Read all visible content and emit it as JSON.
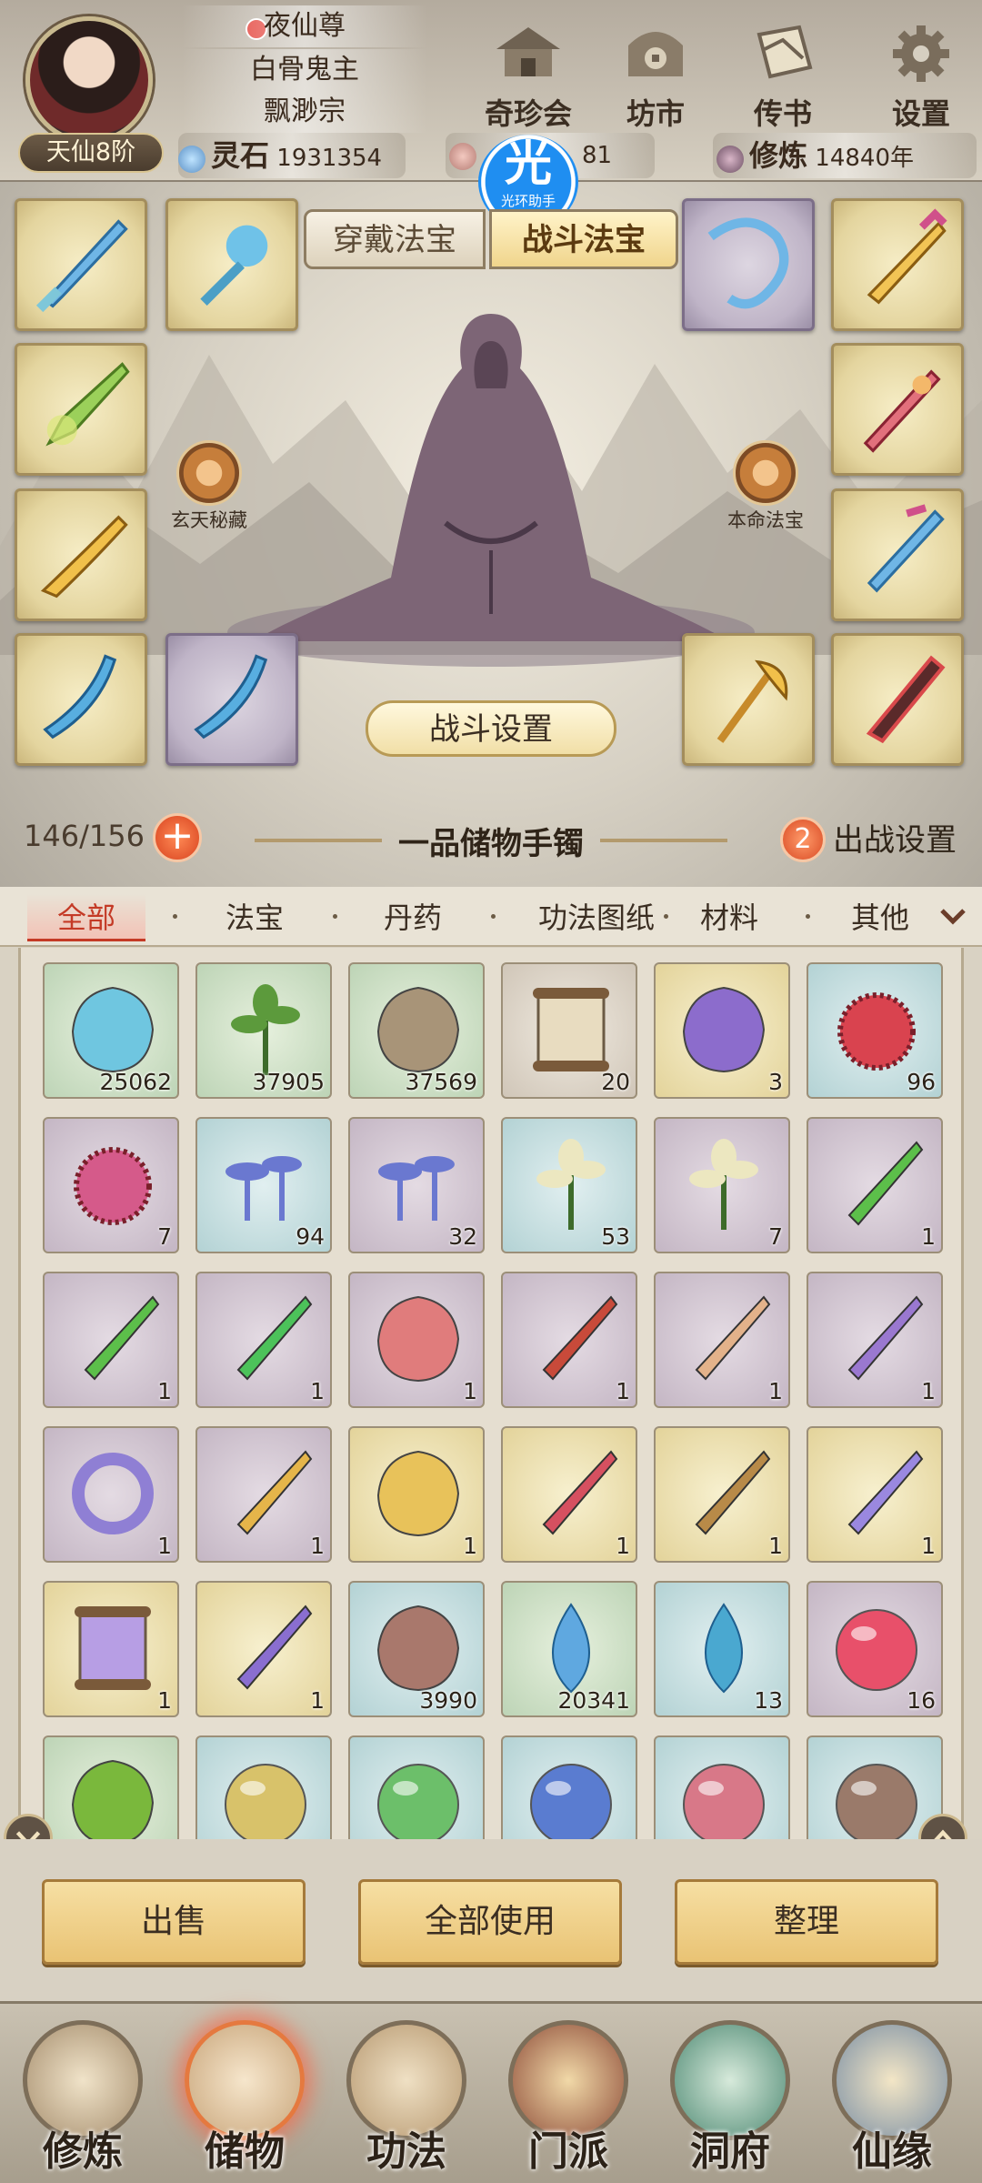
{
  "header": {
    "rank": "天仙8阶",
    "titles": [
      "夜仙尊",
      "白骨鬼主",
      "飘渺宗"
    ],
    "buttons": [
      {
        "label": "奇珍会",
        "icon": "treasure-pavilion-icon"
      },
      {
        "label": "坊市",
        "icon": "market-icon"
      },
      {
        "label": "传书",
        "icon": "scroll-letter-icon"
      },
      {
        "label": "设置",
        "icon": "gear-icon"
      }
    ],
    "resources": {
      "spirit_stone_label": "灵石",
      "spirit_stone_value": "1931354",
      "second_value": "81",
      "cultivation_label": "修炼",
      "cultivation_value": "14840年"
    },
    "helper": {
      "glyph": "光",
      "label": "光环助手"
    }
  },
  "equip": {
    "tabs": {
      "wear": "穿戴法宝",
      "battle": "战斗法宝"
    },
    "left_skill": "玄天秘藏",
    "right_skill": "本命法宝",
    "battle_settings": "战斗设置"
  },
  "storage": {
    "capacity": "146/156",
    "plus": "+",
    "title": "一品储物手镯",
    "deploy_count": "2",
    "deploy_label": "出战设置"
  },
  "categories": [
    "全部",
    "法宝",
    "丹药",
    "功法图纸",
    "材料",
    "其他"
  ],
  "items": [
    {
      "count": "25062",
      "rarity": "green",
      "icon": "blue-crystal-icon"
    },
    {
      "count": "37905",
      "rarity": "green",
      "icon": "herb-sprout-icon"
    },
    {
      "count": "37569",
      "rarity": "green",
      "icon": "ore-stone-icon"
    },
    {
      "count": "20",
      "rarity": "gray",
      "icon": "scroll-icon"
    },
    {
      "count": "3",
      "rarity": "gold",
      "icon": "purple-vase-icon"
    },
    {
      "count": "96",
      "rarity": "blue",
      "icon": "red-spiky-fruit-icon"
    },
    {
      "count": "7",
      "rarity": "purple",
      "icon": "pink-spiky-fruit-icon"
    },
    {
      "count": "94",
      "rarity": "blue",
      "icon": "blue-mushroom-icon"
    },
    {
      "count": "32",
      "rarity": "purple",
      "icon": "blue-mushroom-icon"
    },
    {
      "count": "53",
      "rarity": "blue",
      "icon": "white-flower-icon"
    },
    {
      "count": "7",
      "rarity": "purple",
      "icon": "white-flower-icon"
    },
    {
      "count": "1",
      "rarity": "purple",
      "icon": "green-dagger-icon"
    },
    {
      "count": "1",
      "rarity": "purple",
      "icon": "green-dagger-icon"
    },
    {
      "count": "1",
      "rarity": "purple",
      "icon": "green-leaf-blade-icon"
    },
    {
      "count": "1",
      "rarity": "purple",
      "icon": "red-rock-icon"
    },
    {
      "count": "1",
      "rarity": "purple",
      "icon": "red-axe-icon"
    },
    {
      "count": "1",
      "rarity": "purple",
      "icon": "bone-bow-icon"
    },
    {
      "count": "1",
      "rarity": "purple",
      "icon": "purple-bow-icon"
    },
    {
      "count": "1",
      "rarity": "purple",
      "icon": "purple-ring-icon"
    },
    {
      "count": "1",
      "rarity": "purple",
      "icon": "gold-scimitar-icon"
    },
    {
      "count": "1",
      "rarity": "gold",
      "icon": "golden-bell-icon"
    },
    {
      "count": "1",
      "rarity": "gold",
      "icon": "red-sword-icon"
    },
    {
      "count": "1",
      "rarity": "gold",
      "icon": "bronze-axe-icon"
    },
    {
      "count": "1",
      "rarity": "gold",
      "icon": "lightning-spear-icon"
    },
    {
      "count": "1",
      "rarity": "gold",
      "icon": "purple-scroll-icon"
    },
    {
      "count": "1",
      "rarity": "gold",
      "icon": "purple-staff-icon"
    },
    {
      "count": "3990",
      "rarity": "blue",
      "icon": "sand-pile-icon"
    },
    {
      "count": "20341",
      "rarity": "green",
      "icon": "water-drop-icon"
    },
    {
      "count": "13",
      "rarity": "blue",
      "icon": "wave-icon"
    },
    {
      "count": "16",
      "rarity": "purple",
      "icon": "red-orb-icon"
    },
    {
      "count": "",
      "rarity": "green",
      "icon": "cauldron-icon"
    },
    {
      "count": "",
      "rarity": "blue",
      "icon": "yellow-pill-icon"
    },
    {
      "count": "",
      "rarity": "blue",
      "icon": "green-pill-icon"
    },
    {
      "count": "",
      "rarity": "blue",
      "icon": "blue-pill-icon"
    },
    {
      "count": "",
      "rarity": "blue",
      "icon": "pink-pill-icon"
    },
    {
      "count": "",
      "rarity": "blue",
      "icon": "brown-pill-icon"
    }
  ],
  "actions": [
    "出售",
    "全部使用",
    "整理"
  ],
  "bottom_nav": [
    {
      "label": "修炼",
      "icon": "meditation-icon"
    },
    {
      "label": "储物",
      "icon": "bag-icon"
    },
    {
      "label": "功法",
      "icon": "book-icon"
    },
    {
      "label": "门派",
      "icon": "temple-icon"
    },
    {
      "label": "洞府",
      "icon": "cave-mountain-icon"
    },
    {
      "label": "仙缘",
      "icon": "fate-swirl-icon"
    }
  ]
}
